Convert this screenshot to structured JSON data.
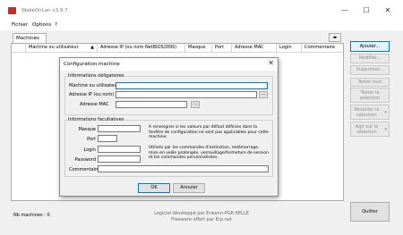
{
  "window": {
    "title": "WakeOnLan v3.9.7",
    "controls": {
      "minimize": "—",
      "maximize": "☐",
      "close": "✕"
    }
  },
  "menu": {
    "items": [
      "Fichier",
      "Options",
      "?"
    ]
  },
  "tabs": {
    "active": "Machines",
    "arrows": "◂▸"
  },
  "table": {
    "columns": [
      "Machine ou utilisateur",
      "Adresse IP (ou nom NetBIOS/DNS)",
      "Masque",
      "Port",
      "Adresse MAC",
      "Login",
      "Commentaire"
    ],
    "sort_indicator": "▲",
    "rows": []
  },
  "sidebar": {
    "buttons": [
      "Ajouter...",
      "Modifier...",
      "Supprimer...",
      "Tester tout",
      "Tester la sélection",
      "Réveiller la sélection",
      "Agir sur la sélection",
      "Quitter"
    ],
    "dropdown_arrow": "▾"
  },
  "status": {
    "count_label": "Nb machines : 0"
  },
  "footer": {
    "line1": "Logiciel développé par Erwann-PGR KELLE",
    "line2": "Freeware offert par Erp.net"
  },
  "dialog": {
    "title": "Configuration machine",
    "close": "✕",
    "required": {
      "title": "Informations obligatoires",
      "name_label": "Machine ou utilisateur",
      "ip_label": "Adresse IP (ou nom)",
      "mac_label": "Adresse MAC",
      "browse": "..."
    },
    "optional": {
      "title": "Informations facultatives",
      "mask_label": "Masque",
      "port_label": "Port",
      "login_label": "Login",
      "password_label": "Password",
      "comment_label": "Commentaire",
      "note1": "A renseigner si les valeurs par défaut définies dans la fenêtre de configuration ne sont pas applicables pour cette machine.",
      "note2": "Utilisés par les commandes d'extinction, redémarrage, mise en veille prolongée, verrouillage/fermeture de session et les commandes personnalisées."
    },
    "ok": "OK",
    "cancel": "Annuler"
  }
}
